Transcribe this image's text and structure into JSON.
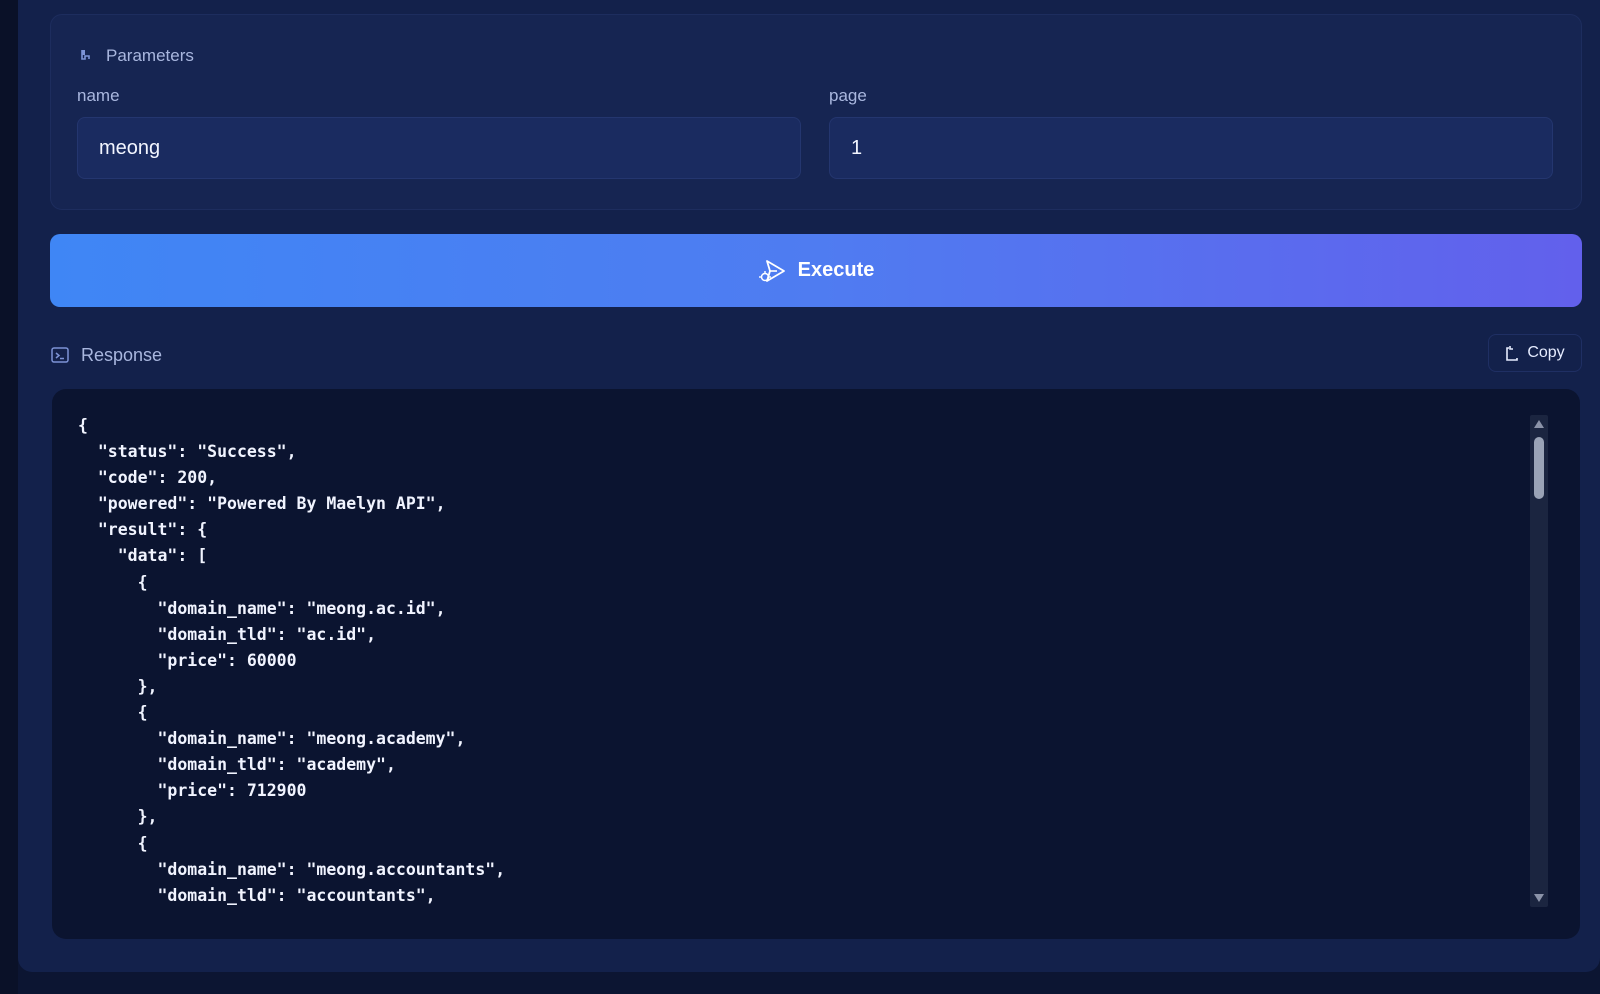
{
  "parameters": {
    "title": "Parameters",
    "icon": "parameters-icon",
    "fields": [
      {
        "label": "name",
        "value": "meong"
      },
      {
        "label": "page",
        "value": "1"
      }
    ]
  },
  "execute": {
    "label": "Execute",
    "icon": "send-icon"
  },
  "response": {
    "title": "Response",
    "icon": "terminal-icon",
    "copy_label": "Copy",
    "copy_icon": "clipboard-icon",
    "body": "{\n  \"status\": \"Success\",\n  \"code\": 200,\n  \"powered\": \"Powered By Maelyn API\",\n  \"result\": {\n    \"data\": [\n      {\n        \"domain_name\": \"meong.ac.id\",\n        \"domain_tld\": \"ac.id\",\n        \"price\": 60000\n      },\n      {\n        \"domain_name\": \"meong.academy\",\n        \"domain_tld\": \"academy\",\n        \"price\": 712900\n      },\n      {\n        \"domain_name\": \"meong.accountants\",\n        \"domain_tld\": \"accountants\","
  },
  "colors": {
    "background": "#0d1736",
    "card": "#13214b",
    "input": "#1a2b60",
    "button_gradient_start": "#3f86f5",
    "button_gradient_end": "#6260ec",
    "code_background": "#0b1430",
    "muted_text": "#a9b7df"
  }
}
